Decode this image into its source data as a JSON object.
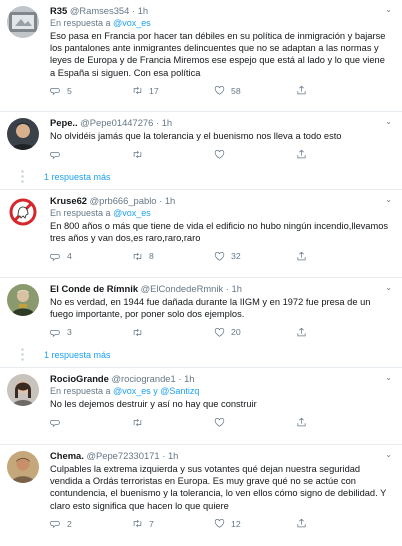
{
  "icons": {
    "reply": "reply-icon",
    "retweet": "retweet-icon",
    "like": "heart-icon",
    "share": "share-icon",
    "more": "chevron-down-icon"
  },
  "colors": {
    "accent": "#1da1f2",
    "muted": "#657786",
    "divider": "#e6ecf0"
  },
  "tweets": [
    {
      "name": "R35",
      "handle": "@Ramses354",
      "time": "1h",
      "reply_prefix": "En respuesta a",
      "reply_to": "@vox_es",
      "text": "Eso pasa en Francia por hacer tan débiles en su política de inmigración y bajarse los pantalones ante inmigrantes delincuentes que no se adaptan a las normas y leyes de Europa y de Francia Miremos ese espejo que está al lado y lo que viene a España si siguen. Con esa política",
      "replies": "5",
      "retweets": "17",
      "likes": "58"
    },
    {
      "name": "Pepe..",
      "handle": "@Pepe01447276",
      "time": "1h",
      "text": "No olvidéis jamás que la tolerancia y el buenismo nos lleva a todo esto",
      "replies": "",
      "retweets": "",
      "likes": "",
      "more_replies": "1 respuesta más"
    },
    {
      "name": "Kruse62",
      "handle": "@prb666_pablo",
      "time": "1h",
      "reply_prefix": "En respuesta a",
      "reply_to": "@vox_es",
      "text": "En 800 años o más que tiene de vida el edificio no hubo ningún incendio,llevamos tres años y van dos,es raro,raro,raro",
      "replies": "4",
      "retweets": "8",
      "likes": "32"
    },
    {
      "name": "El Conde de Rímnik",
      "handle": "@ElCondedeRmnik",
      "time": "1h",
      "text": "No es verdad, en 1944 fue dañada durante la IIGM y en 1972 fue presa de un fuego importante, por poner solo dos ejemplos.",
      "replies": "3",
      "retweets": "",
      "likes": "20",
      "more_replies": "1 respuesta más"
    },
    {
      "name": "RocioGrande",
      "handle": "@rociogrande1",
      "time": "1h",
      "reply_prefix": "En respuesta a",
      "reply_to": "@vox_es y @Santizq",
      "text": "No les dejemos destruir y así no hay que construir",
      "replies": "",
      "retweets": "",
      "likes": ""
    },
    {
      "name": "Chema.",
      "handle": "@Pepe72330171",
      "time": "1h",
      "text": "Culpables la extrema izquierda y sus votantes qué dejan nuestra seguridad vendida a Ordás terroristas en Europa. Es muy grave qué no se actúe con contundencia, el buenismo y la tolerancia, lo ven ellos cómo signo de debilidad. Y claro esto significa que hacen lo que quiere",
      "replies": "2",
      "retweets": "7",
      "likes": "12"
    }
  ]
}
